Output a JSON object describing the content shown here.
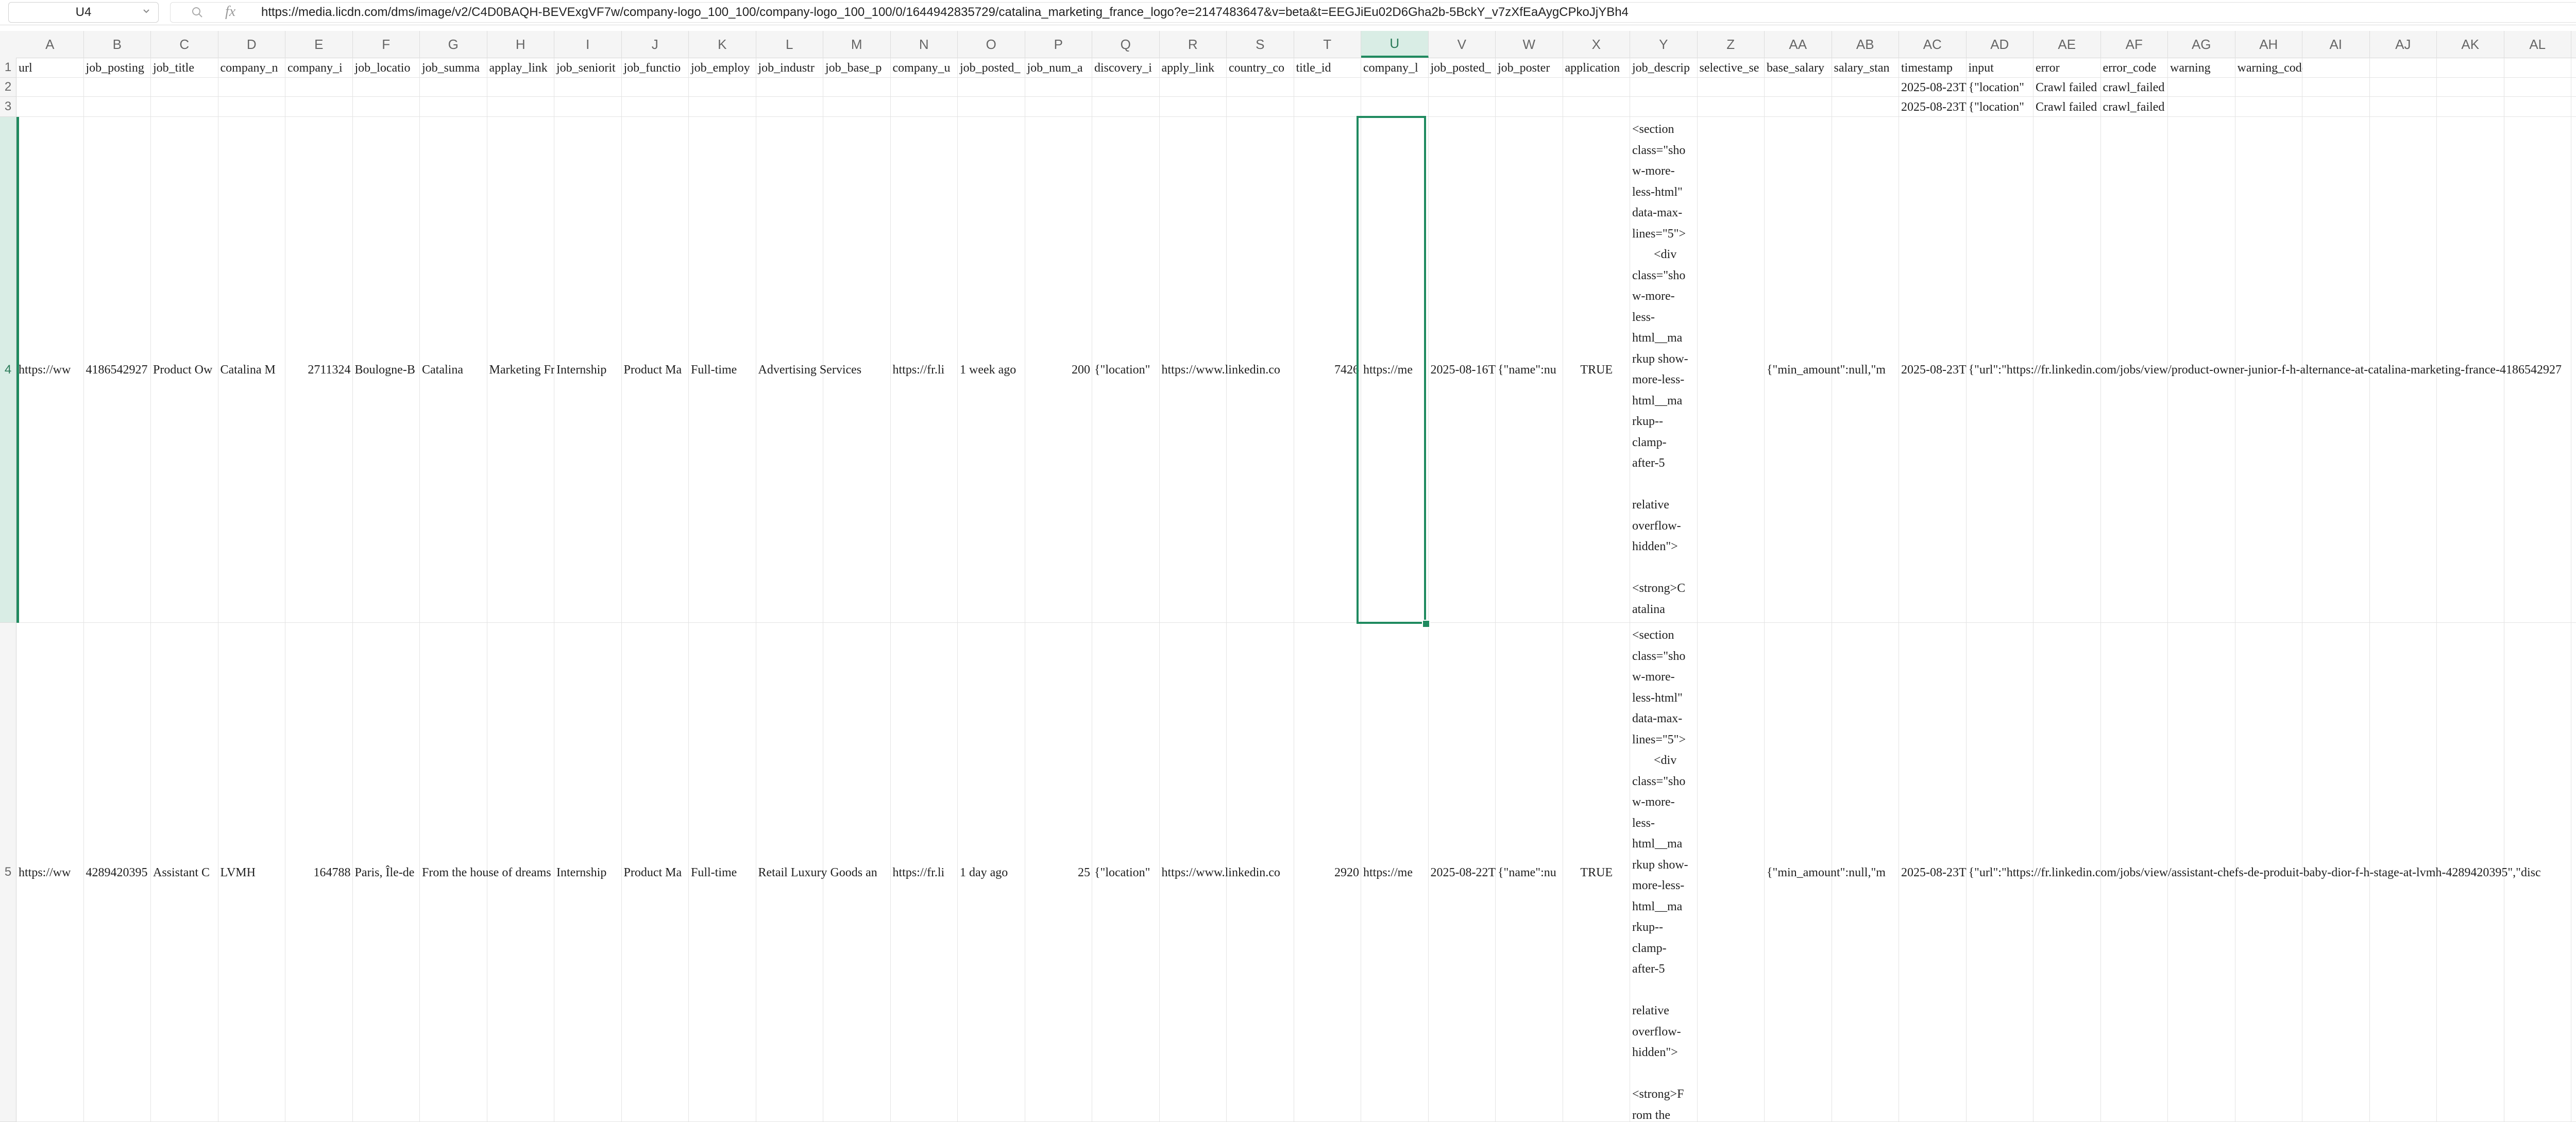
{
  "formula_bar": {
    "name_box": "U4",
    "fx_label": "fx",
    "formula": "https://media.licdn.com/dms/image/v2/C4D0BAQH-BEVExgVF7w/company-logo_100_100/company-logo_100_100/0/1644942835729/catalina_marketing_france_logo?e=2147483647&v=beta&t=EEGJiEu02D6Gha2b-5BckY_v7zXfEaAygCPkoJjYBh4"
  },
  "colors": {
    "accent": "#1f8a5f",
    "header_bg": "#f5f5f5",
    "selected_header_bg": "#d9ede5"
  },
  "selected_column": "U",
  "selected_row": "4",
  "columns": [
    "A",
    "B",
    "C",
    "D",
    "E",
    "F",
    "G",
    "H",
    "I",
    "J",
    "K",
    "L",
    "M",
    "N",
    "O",
    "P",
    "Q",
    "R",
    "S",
    "T",
    "U",
    "V",
    "W",
    "X",
    "Y",
    "Z",
    "AA",
    "AB",
    "AC",
    "AD",
    "AE",
    "AF",
    "AG",
    "AH",
    "AI",
    "AJ",
    "AK",
    "AL",
    "AM"
  ],
  "row_numbers": [
    "1",
    "2",
    "3",
    "4",
    "5"
  ],
  "headers": [
    "url",
    "job_posting",
    "job_title",
    "company_n",
    "company_i",
    "job_locatio",
    "job_summa",
    "applay_link",
    "job_seniorit",
    "job_functio",
    "job_employ",
    "job_industr",
    "job_base_p",
    "company_u",
    "job_posted_",
    "job_num_a",
    "discovery_i",
    "apply_link",
    "country_co",
    "title_id",
    "company_l",
    "job_posted_",
    "job_poster",
    "application",
    "job_descrip",
    "selective_se",
    "base_salary",
    "salary_stan",
    "timestamp",
    "input",
    "error",
    "error_code",
    "warning",
    "warning_code"
  ],
  "row2": {
    "timestamp": "2025-08-23T",
    "input": "{\"location\"",
    "error": "Crawl failed",
    "error_code": "crawl_failed"
  },
  "row3": {
    "timestamp": "2025-08-23T",
    "input": "{\"location\"",
    "error": "Crawl failed",
    "error_code": "crawl_failed"
  },
  "row4": {
    "url": "https://ww",
    "job_posting": "4186542927",
    "job_title": "Product Ow",
    "company_n": "Catalina M",
    "company_i": "2711324",
    "job_location": "Boulogne-B",
    "job_summary": "Catalina",
    "applay_link": "Marketing Fra",
    "job_seniority": "Internship",
    "job_function": "Product Ma",
    "job_employ": "Full-time",
    "job_industry": "Advertising Services",
    "company_url": "https://fr.li",
    "job_posted_time": "1 week ago",
    "job_num_applicants": "200",
    "discovery_input": "{\"location\"",
    "apply_link": "https://www.linkedin.co",
    "title_id": "7426",
    "company_logo": "https://me",
    "job_posted_date": "2025-08-16T",
    "job_poster": "{\"name\":nu",
    "application_available": "TRUE",
    "job_description": "<section\nclass=\"sho\nw-more-\nless-html\"\ndata-max-\nlines=\"5\">\n       <div\nclass=\"sho\nw-more-\nless-\nhtml__ma\nrkup show-\nmore-less-\nhtml__ma\nrkup--\nclamp-\nafter-5\n\nrelative\noverflow-\nhidden\">\n\n<strong>C\natalina\nMarketing",
    "base_salary": "{\"min_amount\":null,\"m",
    "timestamp": "2025-08-23T",
    "input": "{\"url\":\"https://fr.linkedin.com/jobs/view/product-owner-junior-f-h-alternance-at-catalina-marketing-france-4186542927"
  },
  "row5": {
    "url": "https://ww",
    "job_posting": "4289420395",
    "job_title": "Assistant C",
    "company_n": "LVMH",
    "company_i": "164788",
    "job_location": "Paris, Île-de",
    "job_summary": "From the house of dreams",
    "job_seniority": "Internship",
    "job_function": "Product Ma",
    "job_employ": "Full-time",
    "job_industry": "Retail Luxury Goods an",
    "company_url": "https://fr.li",
    "job_posted_time": "1 day ago",
    "job_num_applicants": "25",
    "discovery_input": "{\"location\"",
    "apply_link": "https://www.linkedin.co",
    "title_id": "2920",
    "company_logo": "https://me",
    "job_posted_date": "2025-08-22T",
    "job_poster": "{\"name\":nu",
    "application_available": "TRUE",
    "job_description": "<section\nclass=\"sho\nw-more-\nless-html\"\ndata-max-\nlines=\"5\">\n       <div\nclass=\"sho\nw-more-\nless-\nhtml__ma\nrkup show-\nmore-less-\nhtml__ma\nrkup--\nclamp-\nafter-5\n\nrelative\noverflow-\nhidden\">\n\n<strong>F\nrom the\nhouse of",
    "base_salary": "{\"min_amount\":null,\"m",
    "timestamp": "2025-08-23T",
    "input": "{\"url\":\"https://fr.linkedin.com/jobs/view/assistant-chefs-de-produit-baby-dior-f-h-stage-at-lvmh-4289420395\",\"disc"
  }
}
